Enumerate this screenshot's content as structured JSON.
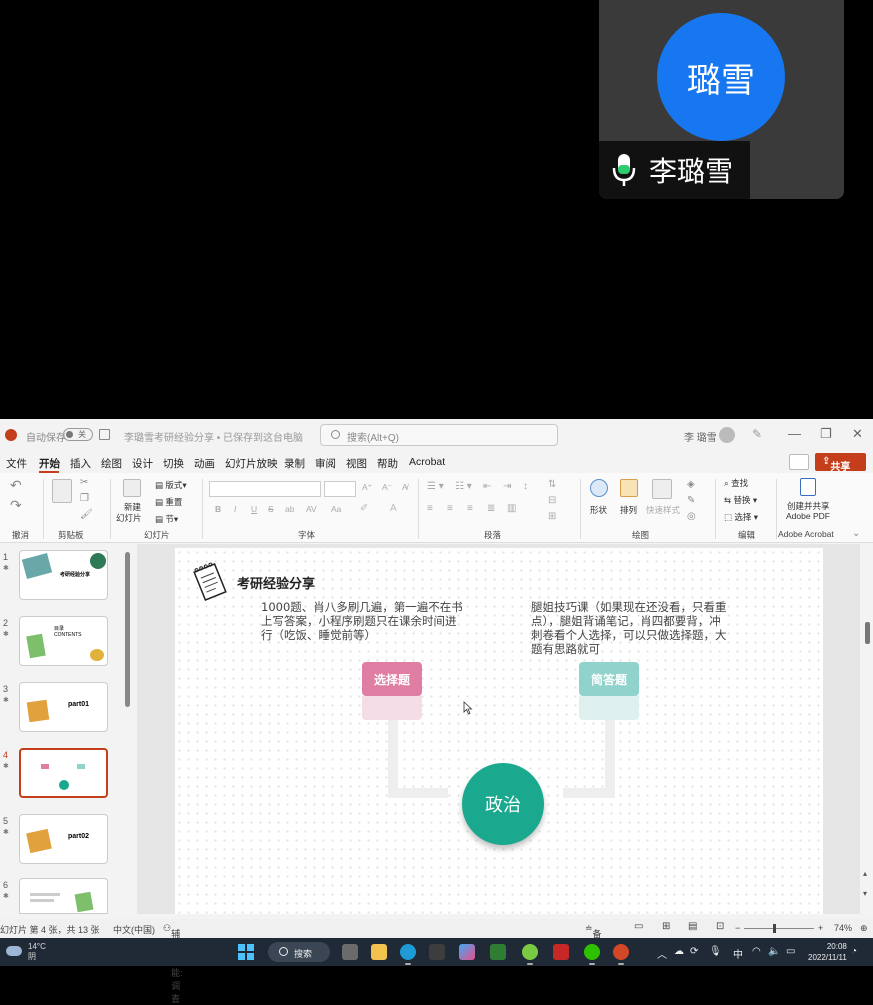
{
  "meeting": {
    "avatar_text": "璐雪",
    "speaker_name": "李璐雪",
    "avatar_color": "#1677f0"
  },
  "titlebar": {
    "autosave_label": "自动保存",
    "autosave_state": "关",
    "doc_title": "李璐雪考研经验分享 • 已保存到这台电脑",
    "search_placeholder": "搜索(Alt+Q)",
    "user_name": "李 璐雪"
  },
  "menu": {
    "items": [
      "文件",
      "开始",
      "插入",
      "绘图",
      "设计",
      "切换",
      "动画",
      "幻灯片放映",
      "录制",
      "审阅",
      "视图",
      "帮助",
      "Acrobat"
    ],
    "share_label": "共享",
    "accent_color": "#c43e1c"
  },
  "ribbon": {
    "groups": [
      "撤消",
      "剪贴板",
      "幻灯片",
      "字体",
      "段落",
      "绘图",
      "编辑",
      "Adobe Acrobat"
    ],
    "new_slide": [
      "新建",
      "幻灯片"
    ],
    "layout": "版式",
    "reset": "重置",
    "section": "节",
    "shapes": "形状",
    "arrange": "排列",
    "quick_styles": "快速样式",
    "find": "查找",
    "replace": "替换",
    "select": "选择",
    "adobe": [
      "创建并共享",
      "Adobe PDF"
    ],
    "font_buttons": [
      "B",
      "I",
      "U",
      "S",
      "ab",
      "AV",
      "Aa"
    ]
  },
  "thumbnails": [
    {
      "num": "1",
      "caption": "考研经验分享"
    },
    {
      "num": "2",
      "caption": "目录 CONTENTS"
    },
    {
      "num": "3",
      "caption": "part01"
    },
    {
      "num": "4",
      "caption": ""
    },
    {
      "num": "5",
      "caption": "part02"
    },
    {
      "num": "6",
      "caption": ""
    }
  ],
  "slide": {
    "title": "考研经验分享",
    "left_text": [
      "1000题、肖八多刷几遍，第一遍不在书",
      "上写答案，小程序刷题只在课余时间进",
      "行（吃饭、睡觉前等）"
    ],
    "right_text": [
      "腿姐技巧课（如果现在还没看，只看重",
      "点），腿姐背诵笔记，肖四都要背，冲",
      "刺卷看个人选择，可以只做选择题，大",
      "题有思路就可"
    ],
    "tag_left": "选择题",
    "tag_right": "简答题",
    "center": "政治",
    "tag_left_color": "#e07da2",
    "tag_right_color": "#8fd3cc",
    "center_color": "#1aa98e"
  },
  "status": {
    "slide_info": "幻灯片 第 4 张，共 13 张",
    "language": "中文(中国)",
    "accessibility": "辅助功能: 调查",
    "notes": "备注",
    "zoom": "74%"
  },
  "taskbar": {
    "temp": "14°C",
    "weather": "阴",
    "search": "搜索",
    "ime": "中",
    "time": "20:08",
    "date": "2022/11/11"
  }
}
